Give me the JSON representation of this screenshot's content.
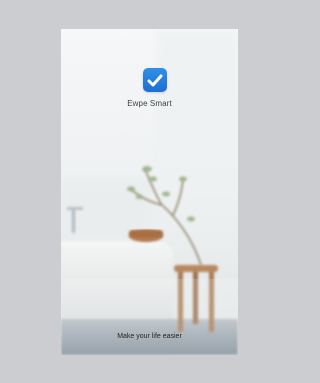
{
  "app": {
    "name": "Ewpe Smart",
    "tagline": "Make your life easier",
    "icon": "ewpe-smart-app-icon",
    "accent": "#1f7ad8"
  }
}
